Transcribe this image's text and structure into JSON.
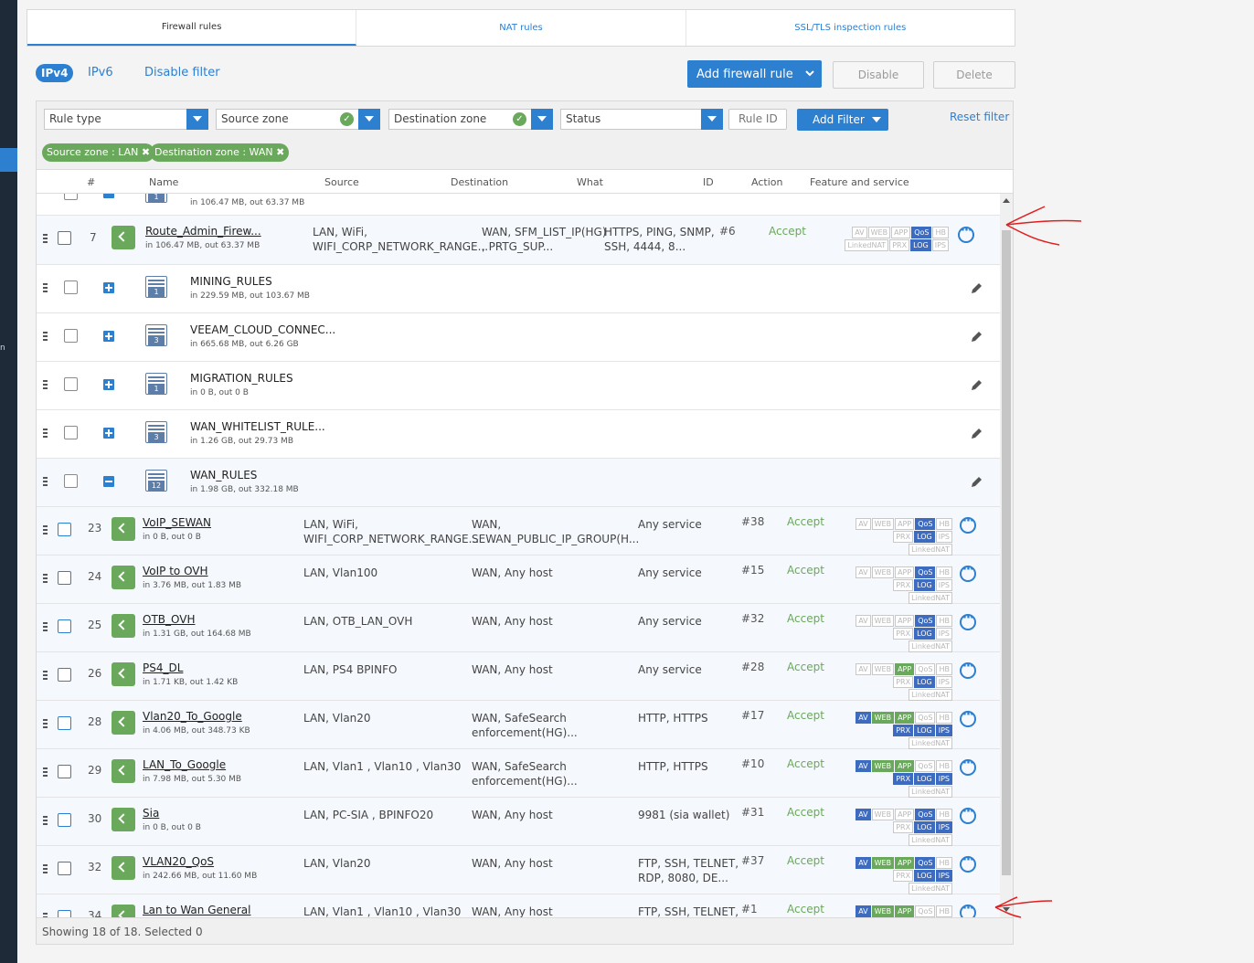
{
  "tabs": [
    {
      "label": "Firewall rules"
    },
    {
      "label": "NAT rules"
    },
    {
      "label": "SSL/TLS inspection rules"
    }
  ],
  "toolbar": {
    "ipv4": "IPv4",
    "ipv6": "IPv6",
    "disable_filter": "Disable filter",
    "add_rule": "Add firewall rule",
    "disable": "Disable",
    "delete": "Delete"
  },
  "filters": {
    "rule_type": "Rule type",
    "source_zone": "Source zone",
    "destination_zone": "Destination zone",
    "status": "Status",
    "rule_id_placeholder": "Rule ID",
    "add_filter": "Add Filter",
    "reset_filter": "Reset filter",
    "chips": [
      "Source zone : LAN",
      "Destination zone : WAN"
    ]
  },
  "columns": {
    "num": "#",
    "name": "Name",
    "source": "Source",
    "destination": "Destination",
    "what": "What",
    "id": "ID",
    "action": "Action",
    "feature": "Feature and service"
  },
  "partial_top_row": {
    "sub": "in 106.47 MB, out 63.37 MB",
    "group_count": "1"
  },
  "rules_top": [
    {
      "num": "7",
      "name": "Route_Admin_Firew...",
      "sub": "in 106.47 MB, out 63.37 MB",
      "source": [
        "LAN, WiFi,",
        "WIFI_CORP_NETWORK_RANGE..."
      ],
      "dest": [
        "WAN, SFM_LIST_IP(HG)",
        ", PRTG_SUP..."
      ],
      "what": [
        "HTTPS, PING, SNMP,",
        "SSH, 4444, 8..."
      ],
      "id": "#6",
      "action": "Accept"
    }
  ],
  "groups": [
    {
      "name": "MINING_RULES",
      "sub": "in 229.59 MB, out 103.67 MB",
      "count": "1",
      "expanded": false
    },
    {
      "name": "VEEAM_CLOUD_CONNEC...",
      "sub": "in 665.68 MB, out 6.26 GB",
      "count": "3",
      "expanded": false
    },
    {
      "name": "MIGRATION_RULES",
      "sub": "in 0 B, out 0 B",
      "count": "1",
      "expanded": false
    },
    {
      "name": "WAN_WHITELIST_RULE...",
      "sub": "in 1.26 GB, out 29.73 MB",
      "count": "3",
      "expanded": false
    },
    {
      "name": "WAN_RULES",
      "sub": "in 1.98 GB, out 332.18 MB",
      "count": "12",
      "expanded": true
    }
  ],
  "rules": [
    {
      "num": "23",
      "name": "VoIP_SEWAN",
      "sub": "in 0 B, out 0 B",
      "source": [
        "LAN, WiFi,",
        "WIFI_CORP_NETWORK_RANGE..."
      ],
      "dest": [
        "WAN,",
        "SEWAN_PUBLIC_IP_GROUP(H..."
      ],
      "what": [
        "Any service"
      ],
      "id": "#38",
      "action": "Accept"
    },
    {
      "num": "24",
      "name": "VoIP to OVH",
      "sub": "in 3.76 MB, out 1.83 MB",
      "source": [
        "LAN, Vlan100"
      ],
      "dest": [
        "WAN, Any host"
      ],
      "what": [
        "Any service"
      ],
      "id": "#15",
      "action": "Accept"
    },
    {
      "num": "25",
      "name": "OTB_OVH",
      "sub": "in 1.31 GB, out 164.68 MB",
      "source": [
        "LAN, OTB_LAN_OVH"
      ],
      "dest": [
        "WAN, Any host"
      ],
      "what": [
        "Any service"
      ],
      "id": "#32",
      "action": "Accept"
    },
    {
      "num": "26",
      "name": "PS4_DL",
      "sub": "in 1.71 KB, out 1.42 KB",
      "source": [
        "LAN, PS4 BPINFO"
      ],
      "dest": [
        "WAN, Any host"
      ],
      "what": [
        "Any service"
      ],
      "id": "#28",
      "action": "Accept"
    },
    {
      "num": "28",
      "name": "Vlan20_To_Google",
      "sub": "in 4.06 MB, out 348.73 KB",
      "source": [
        "LAN, Vlan20"
      ],
      "dest": [
        "WAN, SafeSearch",
        "enforcement(HG)..."
      ],
      "what": [
        "HTTP, HTTPS"
      ],
      "id": "#17",
      "action": "Accept"
    },
    {
      "num": "29",
      "name": "LAN_To_Google",
      "sub": "in 7.98 MB, out 5.30 MB",
      "source": [
        "LAN, Vlan1 , Vlan10 , Vlan30"
      ],
      "dest": [
        "WAN, SafeSearch",
        "enforcement(HG)..."
      ],
      "what": [
        "HTTP, HTTPS"
      ],
      "id": "#10",
      "action": "Accept"
    },
    {
      "num": "30",
      "name": "Sia",
      "sub": "in 0 B, out 0 B",
      "source": [
        "LAN, PC-SIA , BPINFO20"
      ],
      "dest": [
        "WAN, Any host"
      ],
      "what": [
        "9981 (sia wallet)"
      ],
      "id": "#31",
      "action": "Accept"
    },
    {
      "num": "32",
      "name": "VLAN20_QoS",
      "sub": "in 242.66 MB, out 11.60 MB",
      "source": [
        "LAN, Vlan20"
      ],
      "dest": [
        "WAN, Any host"
      ],
      "what": [
        "FTP, SSH, TELNET,",
        "RDP, 8080, DE..."
      ],
      "id": "#37",
      "action": "Accept"
    },
    {
      "num": "34",
      "name": "Lan to Wan General",
      "sub": "",
      "source": [
        "LAN, Vlan1 , Vlan10 , Vlan30"
      ],
      "dest": [
        "WAN, Any host"
      ],
      "what": [
        "FTP, SSH, TELNET,"
      ],
      "id": "#1",
      "action": "Accept"
    }
  ],
  "tag_labels": {
    "av": "AV",
    "web": "WEB",
    "app": "APP",
    "qos": "QoS",
    "hb": "HB",
    "linkednat": "LinkedNAT",
    "prx": "PRX",
    "log": "LOG",
    "ips": "IPS"
  },
  "footer": {
    "text": "Showing 18 of 18. Selected 0"
  },
  "colors": {
    "accent": "#2d7fd0",
    "accept": "#6aa85b",
    "tag_on": "#3d6bbf",
    "annotation": "#e02020"
  }
}
